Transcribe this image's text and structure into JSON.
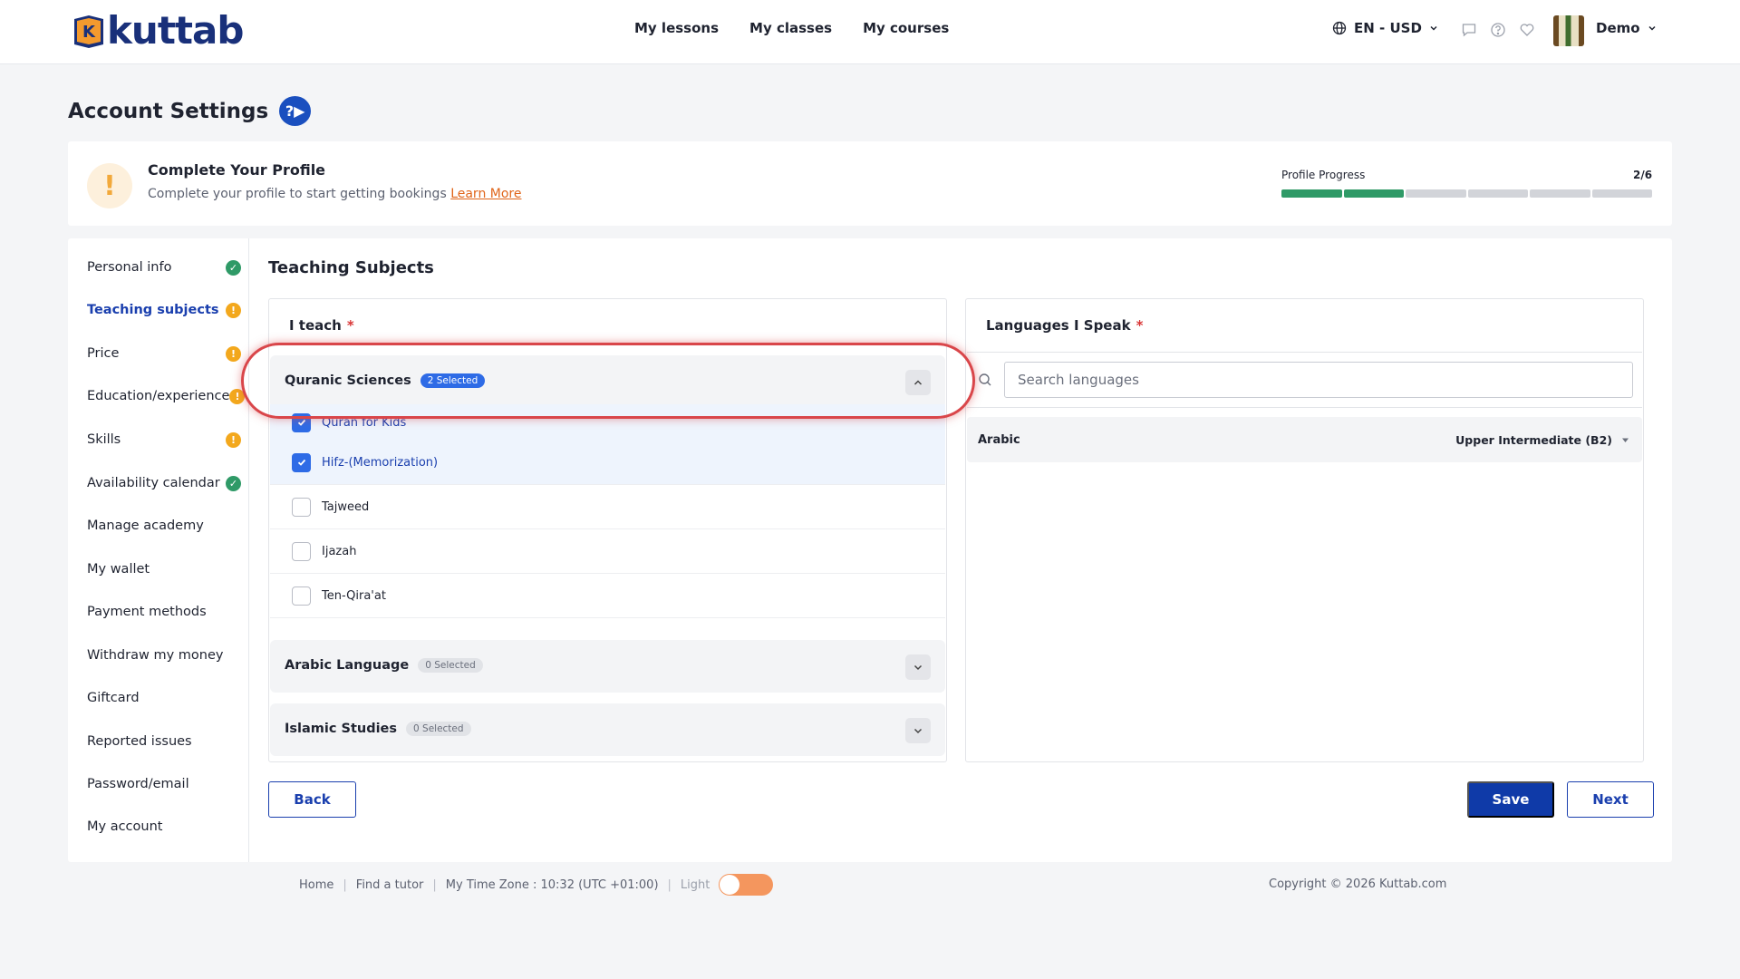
{
  "brand": {
    "name": "kuttab",
    "logo_letter": "K"
  },
  "nav": [
    "My lessons",
    "My classes",
    "My courses"
  ],
  "header": {
    "locale": "EN - USD",
    "user_name": "Demo",
    "icons": [
      "globe-icon",
      "chat-icon",
      "help-icon",
      "heart-icon"
    ]
  },
  "page": {
    "title": "Account Settings",
    "help_glyph": "?▶"
  },
  "profile_prompt": {
    "icon": "!",
    "title": "Complete Your Profile",
    "subtitle": "Complete your profile to start getting bookings",
    "link": "Learn More",
    "progress_label": "Profile Progress",
    "progress_count": "2/6",
    "progress_done": 2,
    "progress_total": 6
  },
  "sidebar": [
    {
      "label": "Personal info",
      "status": "ok"
    },
    {
      "label": "Teaching subjects",
      "status": "warn",
      "active": true
    },
    {
      "label": "Price",
      "status": "warn"
    },
    {
      "label": "Education/experience",
      "status": "warn"
    },
    {
      "label": "Skills",
      "status": "warn"
    },
    {
      "label": "Availability calendar",
      "status": "ok"
    },
    {
      "label": "Manage academy",
      "status": ""
    },
    {
      "label": "My wallet",
      "status": ""
    },
    {
      "label": "Payment methods",
      "status": ""
    },
    {
      "label": "Withdraw my money",
      "status": ""
    },
    {
      "label": "Giftcard",
      "status": ""
    },
    {
      "label": "Reported issues",
      "status": ""
    },
    {
      "label": "Password/email",
      "status": ""
    },
    {
      "label": "My account",
      "status": ""
    }
  ],
  "section_title": "Teaching Subjects",
  "teach": {
    "label": "I teach",
    "required_mark": "*",
    "groups": [
      {
        "title": "Quranic Sciences",
        "badge": "2 Selected",
        "expanded": true,
        "options": [
          {
            "label": "Quran for Kids",
            "checked": true
          },
          {
            "label": "Hifz-(Memorization)",
            "checked": true
          },
          {
            "label": "Tajweed",
            "checked": false
          },
          {
            "label": "Ijazah",
            "checked": false
          },
          {
            "label": "Ten-Qira'at",
            "checked": false
          }
        ]
      },
      {
        "title": "Arabic Language",
        "badge": "0 Selected",
        "expanded": false
      },
      {
        "title": "Islamic Studies",
        "badge": "0 Selected",
        "expanded": false
      }
    ]
  },
  "languages": {
    "label": "Languages I Speak",
    "required_mark": "*",
    "search_placeholder": "Search languages",
    "items": [
      {
        "name": "Arabic",
        "level": "Upper Intermediate (B2)"
      }
    ]
  },
  "buttons": {
    "back": "Back",
    "save": "Save",
    "next": "Next"
  },
  "footer": {
    "links": [
      "Home",
      "Find a tutor",
      "My Time Zone : 10:32 (UTC +01:00)"
    ],
    "theme_label": "Light",
    "copyright": "Copyright © 2026 Kuttab.com"
  },
  "colors": {
    "primary": "#0f3aa8",
    "success": "#2f9a67",
    "warning": "#f3a81d",
    "accent": "#e0651a",
    "highlight": "#d9464a"
  }
}
